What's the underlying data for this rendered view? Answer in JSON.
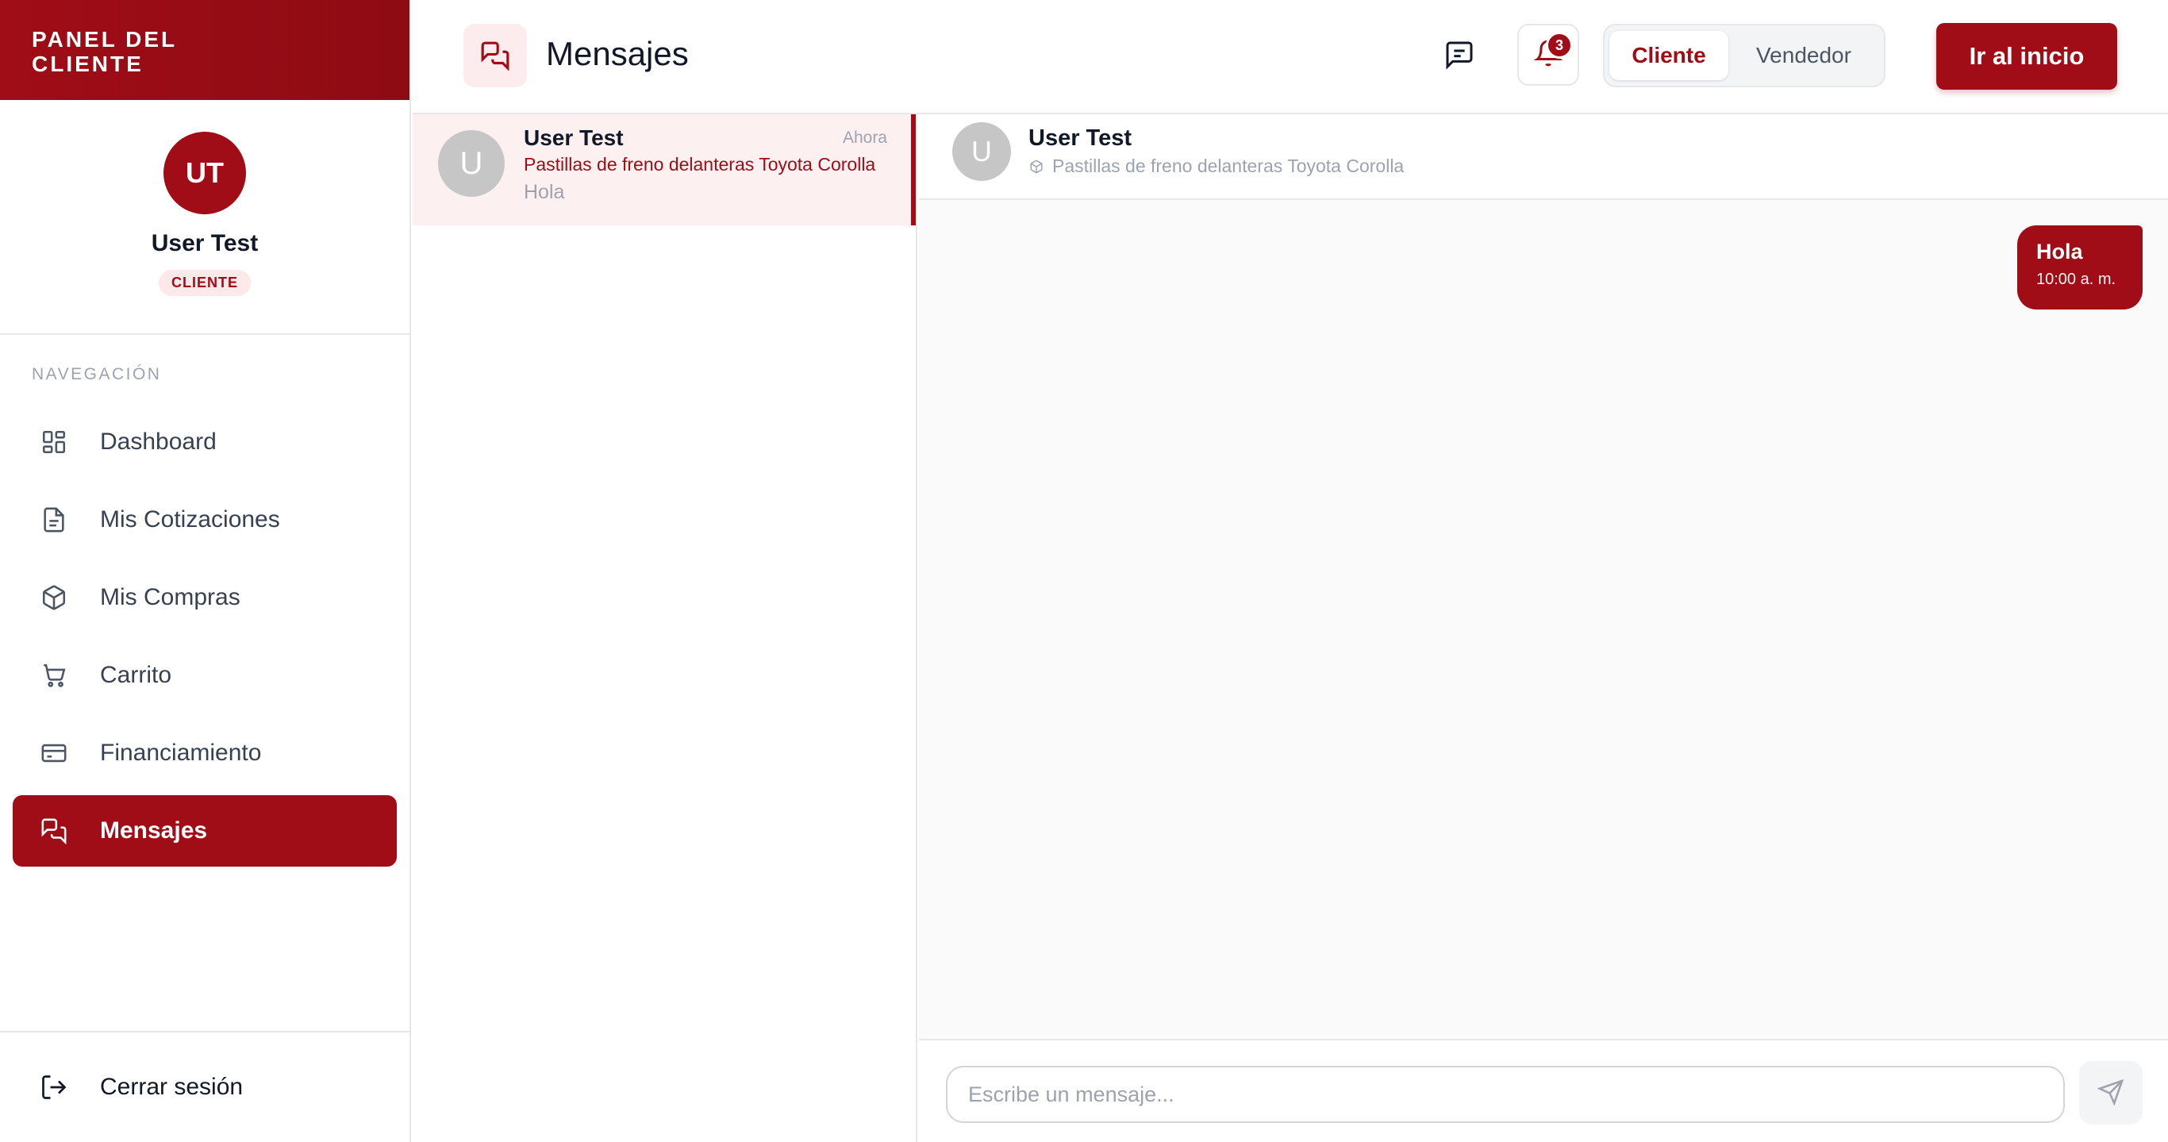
{
  "colors": {
    "accent": "#a00d16",
    "accent_dark": "#8a0b12"
  },
  "sidebar": {
    "header_title": "PANEL DEL CLIENTE",
    "user": {
      "initials": "UT",
      "name": "User Test",
      "role": "CLIENTE"
    },
    "nav_title": "NAVEGACIÓN",
    "items": [
      {
        "label": "Dashboard",
        "icon": "dashboard-icon",
        "active": false
      },
      {
        "label": "Mis Cotizaciones",
        "icon": "document-icon",
        "active": false
      },
      {
        "label": "Mis Compras",
        "icon": "package-icon",
        "active": false
      },
      {
        "label": "Carrito",
        "icon": "cart-icon",
        "active": false
      },
      {
        "label": "Financiamiento",
        "icon": "credit-card-icon",
        "active": false
      },
      {
        "label": "Mensajes",
        "icon": "messages-icon",
        "active": true
      }
    ],
    "logout_label": "Cerrar sesión"
  },
  "topbar": {
    "title": "Mensajes",
    "notification_count": "3",
    "role_switch": {
      "client": "Cliente",
      "seller": "Vendedor",
      "selected": "Cliente"
    },
    "home_button": "Ir al inicio"
  },
  "conversations": [
    {
      "avatar": "U",
      "name": "User Test",
      "time": "Ahora",
      "product": "Pastillas de freno delanteras Toyota Corolla",
      "preview": "Hola",
      "selected": true
    }
  ],
  "chat": {
    "avatar": "U",
    "name": "User Test",
    "product": "Pastillas de freno delanteras Toyota Corolla",
    "messages": [
      {
        "text": "Hola",
        "time": "10:00 a. m.",
        "own": true
      }
    ],
    "input_placeholder": "Escribe un mensaje..."
  }
}
